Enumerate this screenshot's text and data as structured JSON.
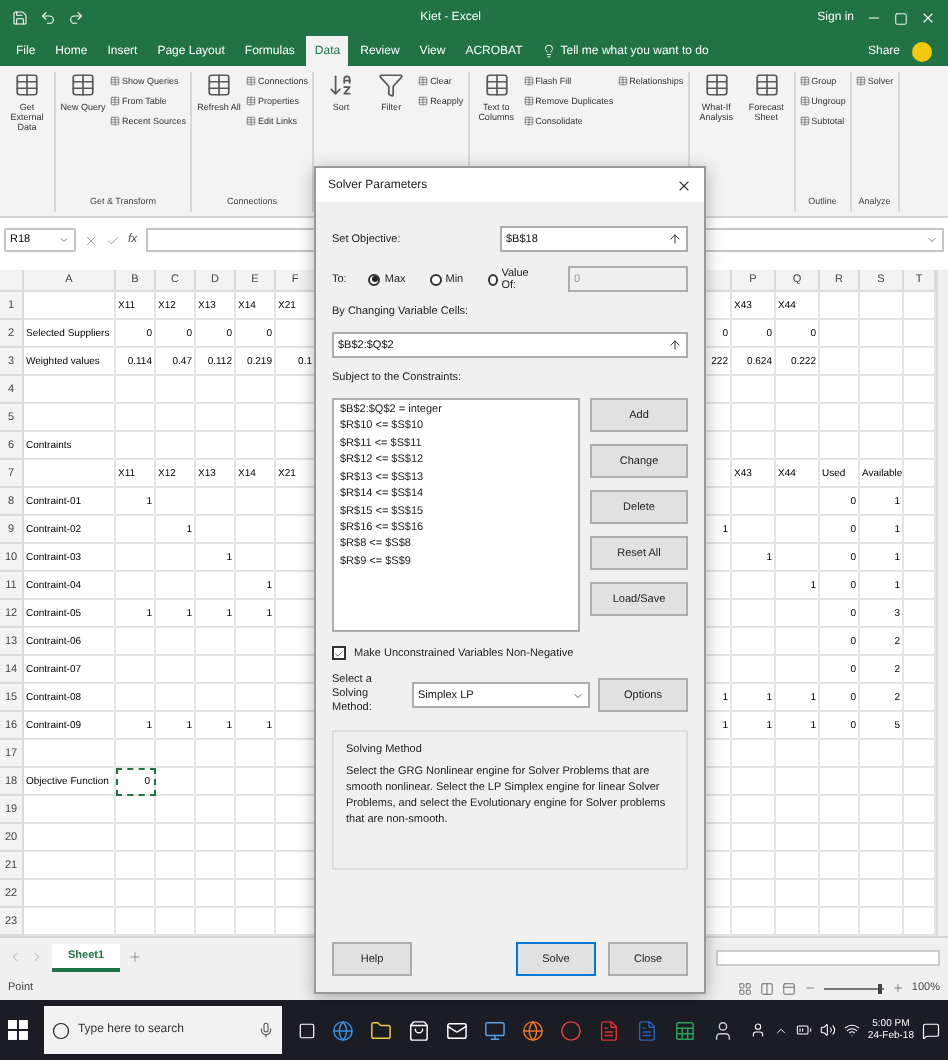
{
  "title_bar": {
    "title": "Kiet - Excel",
    "account": "Sign in"
  },
  "ribbon_tabs": [
    {
      "label": "File",
      "selected": false
    },
    {
      "label": "Home",
      "selected": false
    },
    {
      "label": "Insert",
      "selected": false
    },
    {
      "label": "Page Layout",
      "selected": false
    },
    {
      "label": "Formulas",
      "selected": false
    },
    {
      "label": "Data",
      "selected": true
    },
    {
      "label": "Review",
      "selected": false
    },
    {
      "label": "View",
      "selected": false
    },
    {
      "label": "ACROBAT",
      "selected": false
    }
  ],
  "tell_me": "Tell me what you want to do",
  "share": "Share",
  "ribbon_groups": [
    {
      "commands": [
        {
          "label": "Get External Data",
          "kind": "large"
        }
      ]
    },
    {
      "label": "Get & Transform",
      "commands": [
        {
          "label": "New Query",
          "kind": "large"
        },
        {
          "label": "Show Queries",
          "kind": "small"
        },
        {
          "label": "From Table",
          "kind": "small"
        },
        {
          "label": "Recent Sources",
          "kind": "small"
        }
      ]
    },
    {
      "label": "Connections",
      "commands": [
        {
          "label": "Refresh All",
          "kind": "large"
        },
        {
          "label": "Connections",
          "kind": "small"
        },
        {
          "label": "Properties",
          "kind": "small"
        },
        {
          "label": "Edit Links",
          "kind": "small"
        }
      ]
    },
    {
      "commands": [
        {
          "label": "Sort",
          "kind": "large"
        },
        {
          "label": "Filter",
          "kind": "large"
        },
        {
          "label": "Clear",
          "kind": "small"
        },
        {
          "label": "Reapply",
          "kind": "small"
        }
      ]
    },
    {
      "commands": [
        {
          "label": "Text to Columns",
          "kind": "large"
        },
        {
          "label": "Flash Fill",
          "kind": "small"
        },
        {
          "label": "Remove Duplicates",
          "kind": "small"
        },
        {
          "label": "Consolidate",
          "kind": "small"
        },
        {
          "label": "Relationships",
          "kind": "small"
        }
      ]
    },
    {
      "commands": [
        {
          "label": "What-If Analysis",
          "kind": "large"
        },
        {
          "label": "Forecast Sheet",
          "kind": "large"
        }
      ]
    },
    {
      "label": "Outline",
      "commands": [
        {
          "label": "Group",
          "kind": "small"
        },
        {
          "label": "Ungroup",
          "kind": "small"
        },
        {
          "label": "Subtotal",
          "kind": "small"
        }
      ]
    },
    {
      "label": "Analyze",
      "commands": [
        {
          "label": "Solver",
          "kind": "small"
        }
      ]
    }
  ],
  "formula_bar": {
    "name_box": "R18",
    "function_label": "fx"
  },
  "sheet": {
    "left_columns": [
      "A",
      "B",
      "C",
      "D",
      "E",
      "F"
    ],
    "right_columns": [
      "P",
      "Q",
      "R",
      "S",
      "T"
    ],
    "rows": [
      {
        "number": "1",
        "kind": "labels",
        "B": "X11",
        "C": "X12",
        "D": "X13",
        "E": "X14",
        "F": "X21",
        "P": "X43",
        "Q": "X44"
      },
      {
        "number": "2",
        "kind": "values",
        "A": "Selected Suppliers",
        "B": "0",
        "C": "0",
        "D": "0",
        "E": "0",
        "O": "0",
        "P": "0",
        "Q": "0"
      },
      {
        "number": "3",
        "kind": "values",
        "A": "Weighted values",
        "B": "0.114",
        "C": "0.47",
        "D": "0.112",
        "E": "0.219",
        "F": "0.1",
        "O": "222",
        "P": "0.624",
        "Q": "0.222"
      },
      {
        "number": "4",
        "kind": "values"
      },
      {
        "number": "5",
        "kind": "values"
      },
      {
        "number": "6",
        "kind": "values",
        "A": "Contraints"
      },
      {
        "number": "7",
        "kind": "labels",
        "B": "X11",
        "C": "X12",
        "D": "X13",
        "E": "X14",
        "F": "X21",
        "P": "X43",
        "Q": "X44",
        "R": "Used",
        "S": "Available"
      },
      {
        "number": "8",
        "kind": "values",
        "A": "Contraint-01",
        "B": "1",
        "R": "0",
        "S": "1"
      },
      {
        "number": "9",
        "kind": "values",
        "A": "Contraint-02",
        "C": "1",
        "O": "1",
        "R": "0",
        "S": "1"
      },
      {
        "number": "10",
        "kind": "values",
        "A": "Contraint-03",
        "D": "1",
        "P": "1",
        "R": "0",
        "S": "1"
      },
      {
        "number": "11",
        "kind": "values",
        "A": "Contraint-04",
        "E": "1",
        "Q": "1",
        "R": "0",
        "S": "1"
      },
      {
        "number": "12",
        "kind": "values",
        "A": "Contraint-05",
        "B": "1",
        "C": "1",
        "D": "1",
        "E": "1",
        "R": "0",
        "S": "3"
      },
      {
        "number": "13",
        "kind": "values",
        "A": "Contraint-06",
        "R": "0",
        "S": "2"
      },
      {
        "number": "14",
        "kind": "values",
        "A": "Contraint-07",
        "R": "0",
        "S": "2"
      },
      {
        "number": "15",
        "kind": "values",
        "A": "Contraint-08",
        "O": "1",
        "P": "1",
        "Q": "1",
        "R": "0",
        "S": "2"
      },
      {
        "number": "16",
        "kind": "values",
        "A": "Contraint-09",
        "B": "1",
        "C": "1",
        "D": "1",
        "E": "1",
        "O": "1",
        "P": "1",
        "Q": "1",
        "R": "0",
        "S": "5"
      },
      {
        "number": "17",
        "kind": "values"
      },
      {
        "number": "18",
        "kind": "values",
        "A": "Objective Function",
        "B": {
          "text": "0",
          "marquee": true
        }
      },
      {
        "number": "19",
        "kind": "values"
      },
      {
        "number": "20",
        "kind": "values"
      },
      {
        "number": "21",
        "kind": "values"
      },
      {
        "number": "22",
        "kind": "values"
      },
      {
        "number": "23",
        "kind": "values"
      }
    ]
  },
  "sheet_tabs": [
    {
      "label": "Sheet1",
      "selected": true
    }
  ],
  "status_bar": {
    "mode": "Point",
    "zoom": {
      "level": 0.95,
      "reading": "100%"
    }
  },
  "solver_dialog": {
    "title": "Solver Parameters",
    "objective_label": "Set Objective:",
    "objective": "$B$18",
    "to_label": "To:",
    "goals": [
      {
        "label": "Max",
        "selected": true
      },
      {
        "label": "Min",
        "selected": false
      },
      {
        "label": "Value Of:",
        "selected": false
      }
    ],
    "value_of": "0",
    "variables_label": "By Changing Variable Cells:",
    "variables": "$B$2:$Q$2",
    "constraints_label": "Subject to the Constraints:",
    "constraints": [
      "$B$2:$Q$2 = integer",
      "$R$10 <= $S$10",
      "$R$11 <= $S$11",
      "$R$12 <= $S$12",
      "$R$13 <= $S$13",
      "$R$14 <= $S$14",
      "$R$15 <= $S$15",
      "$R$16 <= $S$16",
      "$R$8 <= $S$8",
      "$R$9 <= $S$9"
    ],
    "side_buttons": [
      "Add",
      "Change",
      "Delete",
      "Reset All",
      "Load/Save"
    ],
    "non_negative": {
      "label": "Make Unconstrained Variables Non-Negative",
      "checked": true
    },
    "method_label": "Select a Solving Method:",
    "method": "Simplex LP",
    "options_button": "Options",
    "method_box": {
      "title": "Solving Method",
      "text": "Select the GRG Nonlinear engine for Solver Problems that are smooth nonlinear. Select the LP Simplex engine for linear Solver Problems, and select the Evolutionary engine for Solver problems that are non-smooth."
    },
    "footer_buttons": [
      {
        "label": "Help",
        "default": false
      },
      {
        "label": "Solve",
        "default": true
      },
      {
        "label": "Close",
        "default": false
      }
    ]
  },
  "taskbar": {
    "search_placeholder": "Type here to search",
    "time": "5:00 PM",
    "date": "24-Feb-18"
  }
}
